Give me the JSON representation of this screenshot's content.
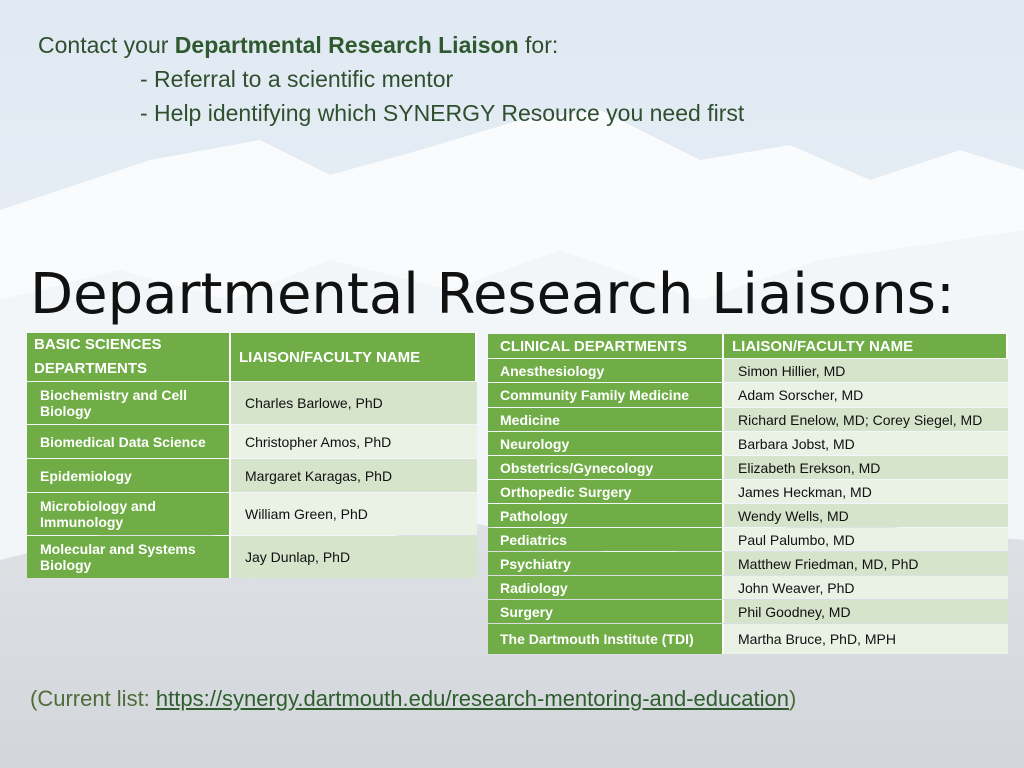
{
  "intro": {
    "prefix": "Contact your ",
    "bold": "Departmental  Research Liaison",
    "suffix": " for:",
    "bullets": [
      "- Referral to a scientific mentor",
      "- Help identifying which SYNERGY Resource you need first"
    ]
  },
  "heading": "Departmental Research Liaisons:",
  "basic": {
    "headers": [
      "BASIC SCIENCES DEPARTMENTS",
      "LIAISON/FACULTY NAME"
    ],
    "rows": [
      {
        "dept": "Biochemistry and Cell Biology",
        "name": "Charles Barlowe, PhD"
      },
      {
        "dept": "Biomedical Data Science",
        "name": "Christopher Amos, PhD"
      },
      {
        "dept": "Epidemiology",
        "name": "Margaret Karagas, PhD"
      },
      {
        "dept": "Microbiology and Immunology",
        "name": "William Green, PhD"
      },
      {
        "dept": "Molecular and Systems Biology",
        "name": "Jay Dunlap, PhD"
      }
    ]
  },
  "clinical": {
    "headers": [
      "CLINICAL DEPARTMENTS",
      "LIAISON/FACULTY NAME"
    ],
    "rows": [
      {
        "dept": "Anesthesiology",
        "name": "Simon Hillier, MD"
      },
      {
        "dept": "Community Family Medicine",
        "name": "Adam Sorscher, MD"
      },
      {
        "dept": "Medicine",
        "name": "Richard Enelow, MD; Corey Siegel, MD"
      },
      {
        "dept": "Neurology",
        "name": "Barbara Jobst, MD"
      },
      {
        "dept": "Obstetrics/Gynecology",
        "name": "Elizabeth Erekson, MD"
      },
      {
        "dept": "Orthopedic Surgery",
        "name": "James Heckman, MD"
      },
      {
        "dept": "Pathology",
        "name": "Wendy Wells, MD"
      },
      {
        "dept": "Pediatrics",
        "name": "Paul Palumbo, MD"
      },
      {
        "dept": "Psychiatry",
        "name": "Matthew Friedman, MD, PhD"
      },
      {
        "dept": "Radiology",
        "name": "John Weaver, PhD"
      },
      {
        "dept": "Surgery",
        "name": "Phil Goodney, MD"
      },
      {
        "dept": "The Dartmouth Institute (TDI)",
        "name": "Martha Bruce, PhD, MPH"
      }
    ]
  },
  "footer": {
    "prefix": "(Current list: ",
    "link": "https://synergy.dartmouth.edu/research-mentoring-and-education",
    "suffix": ")"
  },
  "colors": {
    "header_green": "#70ad47",
    "row_light": "#d5e4cb",
    "row_lighter": "#eaf1e5"
  }
}
